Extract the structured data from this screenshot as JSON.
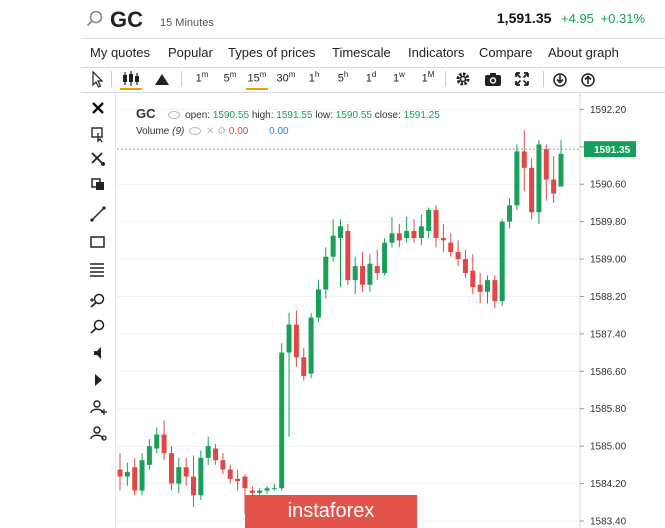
{
  "header": {
    "symbol": "GC",
    "timeframe": "15 Minutes",
    "last_price": "1,591.35",
    "change": "+4.95",
    "change_pct": "+0.31%",
    "search_icon": "search-icon"
  },
  "menu": [
    "My quotes",
    "Popular",
    "Types of prices",
    "Timescale",
    "Indicators",
    "Compare",
    "About graph"
  ],
  "toolbar": {
    "timeframes": [
      {
        "label": "1",
        "sup": "m"
      },
      {
        "label": "5",
        "sup": "m"
      },
      {
        "label": "15",
        "sup": "m"
      },
      {
        "label": "30",
        "sup": "m"
      },
      {
        "label": "1",
        "sup": "h"
      },
      {
        "label": "5",
        "sup": "h"
      },
      {
        "label": "1",
        "sup": "d"
      },
      {
        "label": "1",
        "sup": "w"
      },
      {
        "label": "1",
        "sup": "M"
      }
    ],
    "active_timeframe": "15m",
    "icons": [
      "cursor-icon",
      "candles-icon",
      "mountain-icon",
      "gear-icon",
      "camera-icon",
      "fullscreen-icon",
      "download-icon",
      "upload-icon"
    ]
  },
  "left_tools": [
    "close-icon",
    "select-zoom-icon",
    "delete-drawings-icon",
    "copy-icon",
    "trendline-icon",
    "rectangle-icon",
    "fibonacci-icon",
    "zoom-in-icon",
    "zoom-out-icon",
    "speaker-icon",
    "arrow-icon",
    "user-add-icon",
    "user-settings-icon"
  ],
  "legend": {
    "name": "GC",
    "open_label": "open:",
    "open": "1590.55",
    "high_label": "high:",
    "high": "1591.55",
    "low_label": "low:",
    "low": "1590.55",
    "close_label": "close:",
    "close": "1591.25",
    "volume_label": "Volume",
    "volume_period": "(9)",
    "volume_val1": "0.00",
    "volume_val2": "0.00"
  },
  "watermark": "instaforex",
  "colors": {
    "up": "#18a05a",
    "down": "#e04848",
    "last_tag": "#18a05a"
  },
  "chart_data": {
    "type": "candlestick",
    "price_axis": {
      "ticks": [
        1592.2,
        1591.4,
        1590.6,
        1589.8,
        1589.0,
        1588.2,
        1587.4,
        1586.6,
        1585.8,
        1585.0,
        1584.2,
        1583.4
      ],
      "tick_labels": [
        "1592.20",
        "1591.40",
        "1590.60",
        "1589.80",
        "1589.00",
        "1588.20",
        "1587.40",
        "1586.60",
        "1585.80",
        "1585.00",
        "1584.20",
        "1583.40"
      ],
      "range": [
        1583.25,
        1592.55
      ]
    },
    "last_price": 1591.35,
    "last_price_label": "1591.35",
    "candles": [
      {
        "o": 1584.5,
        "h": 1584.85,
        "l": 1584.05,
        "c": 1584.35
      },
      {
        "o": 1584.35,
        "h": 1584.65,
        "l": 1584.15,
        "c": 1584.45
      },
      {
        "o": 1584.55,
        "h": 1584.75,
        "l": 1583.95,
        "c": 1584.05
      },
      {
        "o": 1584.05,
        "h": 1584.85,
        "l": 1583.95,
        "c": 1584.7
      },
      {
        "o": 1584.6,
        "h": 1585.15,
        "l": 1584.5,
        "c": 1585.0
      },
      {
        "o": 1584.95,
        "h": 1585.4,
        "l": 1584.85,
        "c": 1585.25
      },
      {
        "o": 1585.25,
        "h": 1585.55,
        "l": 1584.7,
        "c": 1584.85
      },
      {
        "o": 1584.85,
        "h": 1585.0,
        "l": 1584.05,
        "c": 1584.2
      },
      {
        "o": 1584.2,
        "h": 1584.75,
        "l": 1584.0,
        "c": 1584.55
      },
      {
        "o": 1584.55,
        "h": 1584.75,
        "l": 1584.15,
        "c": 1584.35
      },
      {
        "o": 1584.35,
        "h": 1584.8,
        "l": 1583.7,
        "c": 1583.95
      },
      {
        "o": 1583.95,
        "h": 1584.9,
        "l": 1583.85,
        "c": 1584.75
      },
      {
        "o": 1584.75,
        "h": 1585.2,
        "l": 1584.6,
        "c": 1585.0
      },
      {
        "o": 1584.95,
        "h": 1585.05,
        "l": 1584.6,
        "c": 1584.7
      },
      {
        "o": 1584.7,
        "h": 1584.85,
        "l": 1584.4,
        "c": 1584.5
      },
      {
        "o": 1584.5,
        "h": 1584.6,
        "l": 1584.2,
        "c": 1584.3
      },
      {
        "o": 1584.3,
        "h": 1584.5,
        "l": 1584.05,
        "c": 1584.25
      },
      {
        "o": 1584.35,
        "h": 1584.4,
        "l": 1583.55,
        "c": 1584.1
      },
      {
        "o": 1584.05,
        "h": 1584.15,
        "l": 1583.95,
        "c": 1584.0
      },
      {
        "o": 1584.0,
        "h": 1584.1,
        "l": 1583.95,
        "c": 1584.05
      },
      {
        "o": 1584.05,
        "h": 1584.15,
        "l": 1583.98,
        "c": 1584.1
      },
      {
        "o": 1584.1,
        "h": 1584.2,
        "l": 1584.05,
        "c": 1584.1
      },
      {
        "o": 1584.1,
        "h": 1587.2,
        "l": 1584.05,
        "c": 1587.0
      },
      {
        "o": 1587.0,
        "h": 1587.85,
        "l": 1585.2,
        "c": 1587.6
      },
      {
        "o": 1587.6,
        "h": 1587.9,
        "l": 1586.7,
        "c": 1586.9
      },
      {
        "o": 1586.9,
        "h": 1587.1,
        "l": 1586.4,
        "c": 1586.5
      },
      {
        "o": 1586.55,
        "h": 1587.85,
        "l": 1586.45,
        "c": 1587.75
      },
      {
        "o": 1587.75,
        "h": 1588.55,
        "l": 1587.65,
        "c": 1588.35
      },
      {
        "o": 1588.35,
        "h": 1589.25,
        "l": 1588.15,
        "c": 1589.05
      },
      {
        "o": 1589.05,
        "h": 1589.85,
        "l": 1588.95,
        "c": 1589.5
      },
      {
        "o": 1589.45,
        "h": 1589.85,
        "l": 1588.4,
        "c": 1589.7
      },
      {
        "o": 1589.6,
        "h": 1589.75,
        "l": 1588.45,
        "c": 1588.55
      },
      {
        "o": 1588.55,
        "h": 1589.05,
        "l": 1588.25,
        "c": 1588.85
      },
      {
        "o": 1588.85,
        "h": 1589.15,
        "l": 1588.3,
        "c": 1588.45
      },
      {
        "o": 1588.45,
        "h": 1589.1,
        "l": 1588.3,
        "c": 1588.9
      },
      {
        "o": 1588.85,
        "h": 1589.2,
        "l": 1588.55,
        "c": 1588.7
      },
      {
        "o": 1588.7,
        "h": 1589.45,
        "l": 1588.65,
        "c": 1589.35
      },
      {
        "o": 1589.35,
        "h": 1589.9,
        "l": 1589.25,
        "c": 1589.55
      },
      {
        "o": 1589.55,
        "h": 1589.75,
        "l": 1589.25,
        "c": 1589.4
      },
      {
        "o": 1589.45,
        "h": 1589.9,
        "l": 1589.35,
        "c": 1589.6
      },
      {
        "o": 1589.6,
        "h": 1589.85,
        "l": 1589.35,
        "c": 1589.45
      },
      {
        "o": 1589.45,
        "h": 1589.95,
        "l": 1589.3,
        "c": 1589.7
      },
      {
        "o": 1589.6,
        "h": 1590.1,
        "l": 1589.45,
        "c": 1590.05
      },
      {
        "o": 1590.05,
        "h": 1590.15,
        "l": 1589.25,
        "c": 1589.45
      },
      {
        "o": 1589.45,
        "h": 1589.75,
        "l": 1589.15,
        "c": 1589.4
      },
      {
        "o": 1589.35,
        "h": 1589.55,
        "l": 1589.05,
        "c": 1589.15
      },
      {
        "o": 1589.15,
        "h": 1589.4,
        "l": 1588.85,
        "c": 1589.0
      },
      {
        "o": 1589.0,
        "h": 1589.2,
        "l": 1588.6,
        "c": 1588.7
      },
      {
        "o": 1588.75,
        "h": 1589.1,
        "l": 1588.25,
        "c": 1588.4
      },
      {
        "o": 1588.45,
        "h": 1588.7,
        "l": 1588.05,
        "c": 1588.3
      },
      {
        "o": 1588.3,
        "h": 1588.65,
        "l": 1588.05,
        "c": 1588.55
      },
      {
        "o": 1588.55,
        "h": 1588.65,
        "l": 1587.95,
        "c": 1588.1
      },
      {
        "o": 1588.1,
        "h": 1589.85,
        "l": 1588.0,
        "c": 1589.8
      },
      {
        "o": 1589.8,
        "h": 1590.3,
        "l": 1589.65,
        "c": 1590.15
      },
      {
        "o": 1590.15,
        "h": 1591.45,
        "l": 1590.05,
        "c": 1591.3
      },
      {
        "o": 1591.3,
        "h": 1591.75,
        "l": 1590.45,
        "c": 1590.95
      },
      {
        "o": 1590.95,
        "h": 1591.15,
        "l": 1589.85,
        "c": 1590.0
      },
      {
        "o": 1590.0,
        "h": 1591.55,
        "l": 1589.75,
        "c": 1591.45
      },
      {
        "o": 1591.35,
        "h": 1591.45,
        "l": 1590.25,
        "c": 1590.7
      },
      {
        "o": 1590.7,
        "h": 1591.2,
        "l": 1590.2,
        "c": 1590.4
      },
      {
        "o": 1590.55,
        "h": 1591.55,
        "l": 1590.55,
        "c": 1591.25
      }
    ]
  }
}
